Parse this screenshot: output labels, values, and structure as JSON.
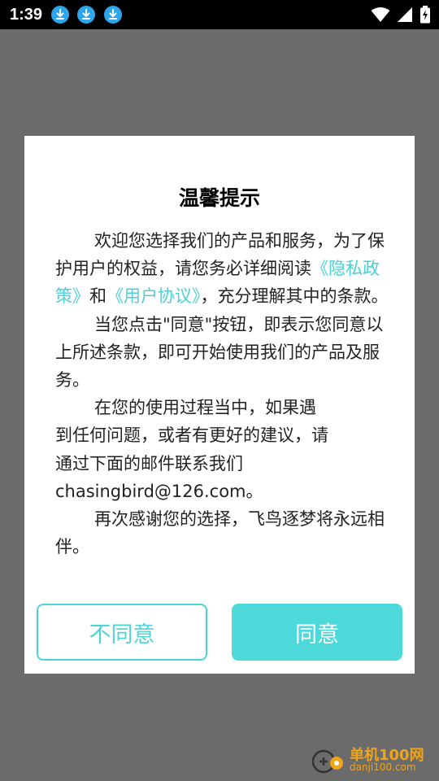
{
  "status_bar": {
    "time": "1:39",
    "download_icons": [
      "download-icon",
      "download-icon",
      "download-icon"
    ],
    "right_icons": [
      "wifi-icon",
      "signal-icon",
      "battery-charging-icon"
    ]
  },
  "dialog": {
    "title": "温馨提示",
    "paragraph1": {
      "text_before": "欢迎您选择我们的产品和服务，为了保护用户的权益，请您务必详细阅读",
      "privacy_link": "《隐私政策》",
      "middle": "和",
      "terms_link": "《用户协议》",
      "text_after": "，充分理解其中的条款。"
    },
    "paragraph2": "当您点击\"同意\"按钮，即表示您同意以上所述条款，即可开始使用我们的产品及服务。",
    "paragraph3": "在您的使用过程当中，如果遇到任何问题，或者有更好的建议，请通过下面的邮件联系我们chasingbird@126.com。",
    "paragraph4": "再次感谢您的选择，飞鸟逐梦将永远相伴。",
    "disagree_label": "不同意",
    "agree_label": "同意"
  },
  "watermark": {
    "title": "单机100网",
    "subtitle": "danji100.com"
  },
  "colors": {
    "accent": "#4dd9da",
    "link": "#4bcfd6",
    "overlay": "#6b6b6b"
  }
}
